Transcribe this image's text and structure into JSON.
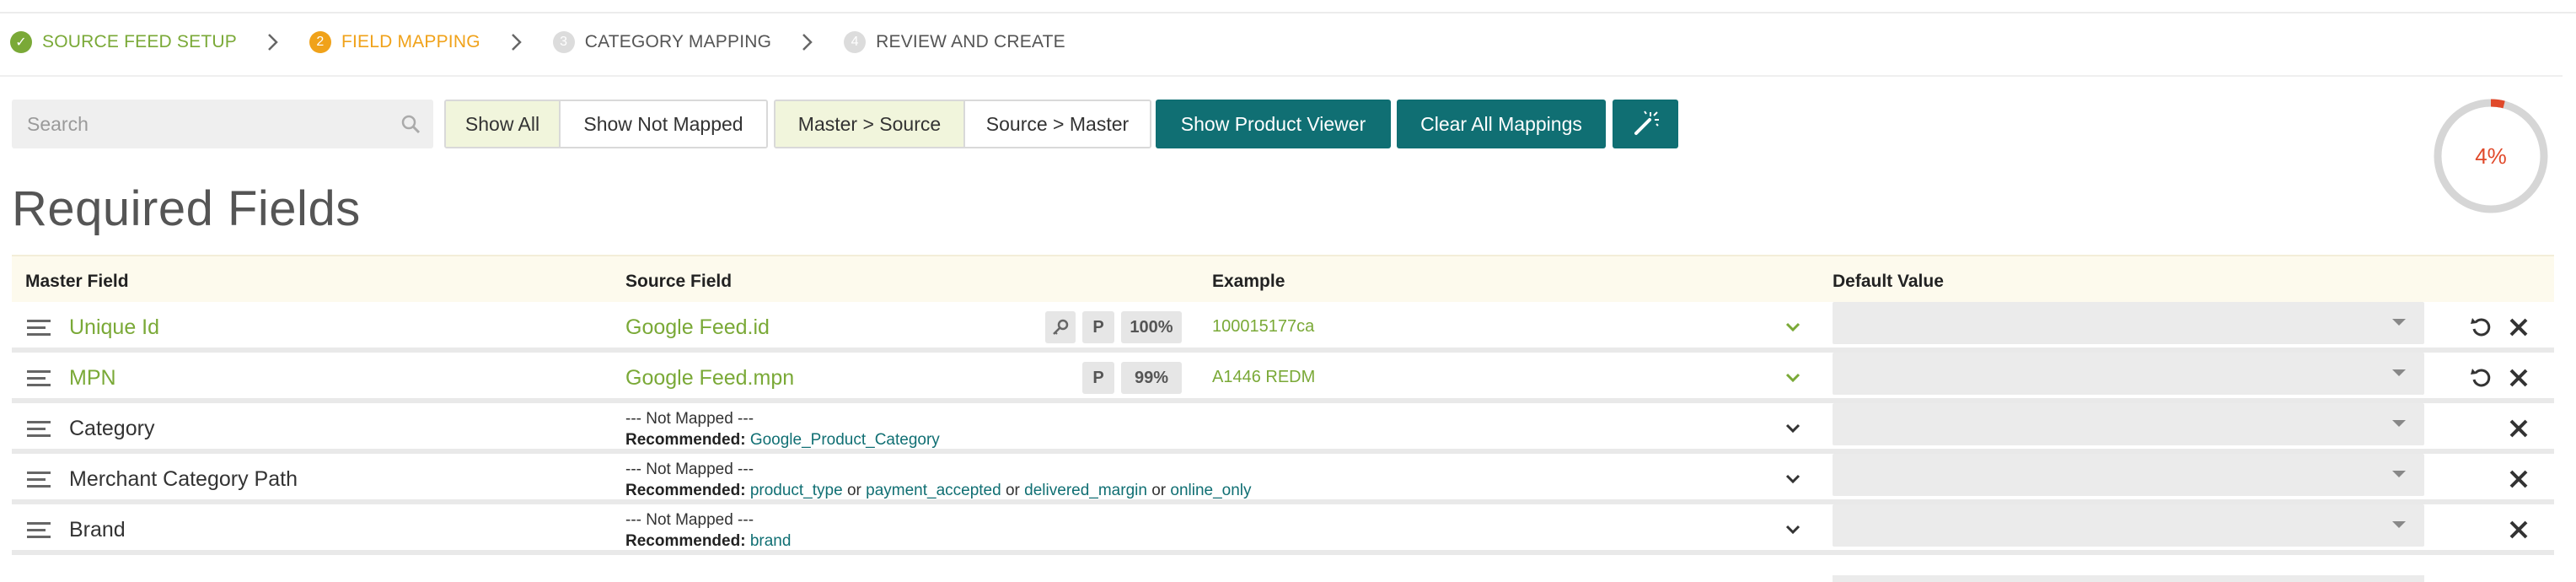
{
  "stepper": {
    "steps": [
      {
        "number": "✓",
        "label": "SOURCE FEED SETUP",
        "state": "done"
      },
      {
        "number": "2",
        "label": "FIELD MAPPING",
        "state": "active"
      },
      {
        "number": "3",
        "label": "CATEGORY MAPPING",
        "state": "pending"
      },
      {
        "number": "4",
        "label": "REVIEW AND CREATE",
        "state": "pending"
      }
    ]
  },
  "toolbar": {
    "search_placeholder": "Search",
    "search_value": "",
    "filter": {
      "show_all": "Show All",
      "show_not_mapped": "Show Not Mapped",
      "selected": "Show All"
    },
    "direction": {
      "master_to_source": "Master > Source",
      "source_to_master": "Source > Master",
      "selected": "Master > Source"
    },
    "show_product_viewer": "Show Product Viewer",
    "clear_all_mappings": "Clear All Mappings",
    "magic_icon": "magic-wand-icon"
  },
  "progress": {
    "label": "4%",
    "value": 0.04,
    "color": "#e0492a"
  },
  "section_title": "Required Fields",
  "table": {
    "headers": {
      "master": "Master Field",
      "source": "Source Field",
      "example": "Example",
      "default": "Default Value"
    },
    "rows": [
      {
        "master": "Unique Id",
        "mapped": true,
        "source": "Google Feed.id",
        "tags": {
          "key": true,
          "p": "P",
          "pct": "100%"
        },
        "example": "100015177ca",
        "default": "",
        "has_reset": true
      },
      {
        "master": "MPN",
        "mapped": true,
        "source": "Google Feed.mpn",
        "tags": {
          "key": false,
          "p": "P",
          "pct": "99%"
        },
        "example": "A1446 REDM",
        "default": "",
        "has_reset": true
      },
      {
        "master": "Category",
        "mapped": false,
        "not_mapped": "--- Not Mapped ---",
        "recommended_label": "Recommended:",
        "recommended": [
          "Google_Product_Category"
        ],
        "default": "",
        "has_reset": false
      },
      {
        "master": "Merchant Category Path",
        "mapped": false,
        "not_mapped": "--- Not Mapped ---",
        "recommended_label": "Recommended:",
        "recommended": [
          "product_type",
          "payment_accepted",
          "delivered_margin",
          "online_only"
        ],
        "default": "",
        "has_reset": false
      },
      {
        "master": "Brand",
        "mapped": false,
        "not_mapped": "--- Not Mapped ---",
        "recommended_label": "Recommended:",
        "recommended": [
          "brand"
        ],
        "default": "",
        "has_reset": false
      }
    ],
    "or_word": "or"
  },
  "colors": {
    "green": "#7aa937",
    "orange": "#f0a21a",
    "teal": "#106f73",
    "red": "#e0492a"
  }
}
